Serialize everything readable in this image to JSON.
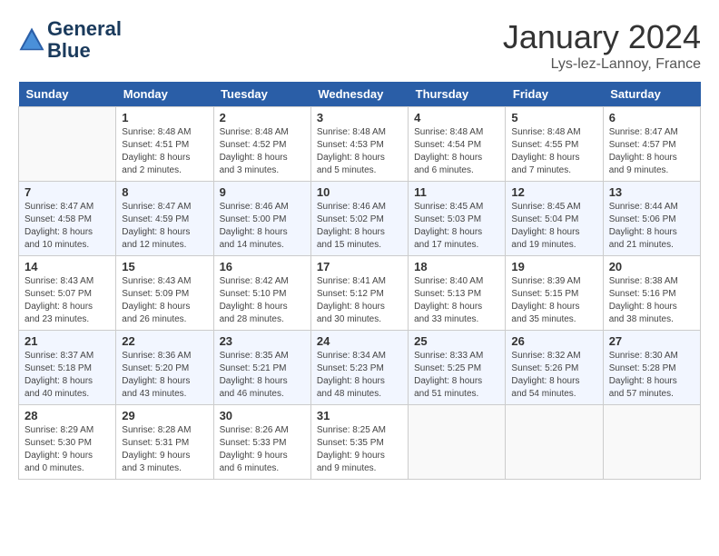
{
  "header": {
    "logo_line1": "General",
    "logo_line2": "Blue",
    "month_year": "January 2024",
    "location": "Lys-lez-Lannoy, France"
  },
  "days_of_week": [
    "Sunday",
    "Monday",
    "Tuesday",
    "Wednesday",
    "Thursday",
    "Friday",
    "Saturday"
  ],
  "weeks": [
    [
      {
        "day": "",
        "empty": true
      },
      {
        "day": "1",
        "sunrise": "Sunrise: 8:48 AM",
        "sunset": "Sunset: 4:51 PM",
        "daylight": "Daylight: 8 hours and 2 minutes."
      },
      {
        "day": "2",
        "sunrise": "Sunrise: 8:48 AM",
        "sunset": "Sunset: 4:52 PM",
        "daylight": "Daylight: 8 hours and 3 minutes."
      },
      {
        "day": "3",
        "sunrise": "Sunrise: 8:48 AM",
        "sunset": "Sunset: 4:53 PM",
        "daylight": "Daylight: 8 hours and 5 minutes."
      },
      {
        "day": "4",
        "sunrise": "Sunrise: 8:48 AM",
        "sunset": "Sunset: 4:54 PM",
        "daylight": "Daylight: 8 hours and 6 minutes."
      },
      {
        "day": "5",
        "sunrise": "Sunrise: 8:48 AM",
        "sunset": "Sunset: 4:55 PM",
        "daylight": "Daylight: 8 hours and 7 minutes."
      },
      {
        "day": "6",
        "sunrise": "Sunrise: 8:47 AM",
        "sunset": "Sunset: 4:57 PM",
        "daylight": "Daylight: 8 hours and 9 minutes."
      }
    ],
    [
      {
        "day": "7",
        "sunrise": "Sunrise: 8:47 AM",
        "sunset": "Sunset: 4:58 PM",
        "daylight": "Daylight: 8 hours and 10 minutes."
      },
      {
        "day": "8",
        "sunrise": "Sunrise: 8:47 AM",
        "sunset": "Sunset: 4:59 PM",
        "daylight": "Daylight: 8 hours and 12 minutes."
      },
      {
        "day": "9",
        "sunrise": "Sunrise: 8:46 AM",
        "sunset": "Sunset: 5:00 PM",
        "daylight": "Daylight: 8 hours and 14 minutes."
      },
      {
        "day": "10",
        "sunrise": "Sunrise: 8:46 AM",
        "sunset": "Sunset: 5:02 PM",
        "daylight": "Daylight: 8 hours and 15 minutes."
      },
      {
        "day": "11",
        "sunrise": "Sunrise: 8:45 AM",
        "sunset": "Sunset: 5:03 PM",
        "daylight": "Daylight: 8 hours and 17 minutes."
      },
      {
        "day": "12",
        "sunrise": "Sunrise: 8:45 AM",
        "sunset": "Sunset: 5:04 PM",
        "daylight": "Daylight: 8 hours and 19 minutes."
      },
      {
        "day": "13",
        "sunrise": "Sunrise: 8:44 AM",
        "sunset": "Sunset: 5:06 PM",
        "daylight": "Daylight: 8 hours and 21 minutes."
      }
    ],
    [
      {
        "day": "14",
        "sunrise": "Sunrise: 8:43 AM",
        "sunset": "Sunset: 5:07 PM",
        "daylight": "Daylight: 8 hours and 23 minutes."
      },
      {
        "day": "15",
        "sunrise": "Sunrise: 8:43 AM",
        "sunset": "Sunset: 5:09 PM",
        "daylight": "Daylight: 8 hours and 26 minutes."
      },
      {
        "day": "16",
        "sunrise": "Sunrise: 8:42 AM",
        "sunset": "Sunset: 5:10 PM",
        "daylight": "Daylight: 8 hours and 28 minutes."
      },
      {
        "day": "17",
        "sunrise": "Sunrise: 8:41 AM",
        "sunset": "Sunset: 5:12 PM",
        "daylight": "Daylight: 8 hours and 30 minutes."
      },
      {
        "day": "18",
        "sunrise": "Sunrise: 8:40 AM",
        "sunset": "Sunset: 5:13 PM",
        "daylight": "Daylight: 8 hours and 33 minutes."
      },
      {
        "day": "19",
        "sunrise": "Sunrise: 8:39 AM",
        "sunset": "Sunset: 5:15 PM",
        "daylight": "Daylight: 8 hours and 35 minutes."
      },
      {
        "day": "20",
        "sunrise": "Sunrise: 8:38 AM",
        "sunset": "Sunset: 5:16 PM",
        "daylight": "Daylight: 8 hours and 38 minutes."
      }
    ],
    [
      {
        "day": "21",
        "sunrise": "Sunrise: 8:37 AM",
        "sunset": "Sunset: 5:18 PM",
        "daylight": "Daylight: 8 hours and 40 minutes."
      },
      {
        "day": "22",
        "sunrise": "Sunrise: 8:36 AM",
        "sunset": "Sunset: 5:20 PM",
        "daylight": "Daylight: 8 hours and 43 minutes."
      },
      {
        "day": "23",
        "sunrise": "Sunrise: 8:35 AM",
        "sunset": "Sunset: 5:21 PM",
        "daylight": "Daylight: 8 hours and 46 minutes."
      },
      {
        "day": "24",
        "sunrise": "Sunrise: 8:34 AM",
        "sunset": "Sunset: 5:23 PM",
        "daylight": "Daylight: 8 hours and 48 minutes."
      },
      {
        "day": "25",
        "sunrise": "Sunrise: 8:33 AM",
        "sunset": "Sunset: 5:25 PM",
        "daylight": "Daylight: 8 hours and 51 minutes."
      },
      {
        "day": "26",
        "sunrise": "Sunrise: 8:32 AM",
        "sunset": "Sunset: 5:26 PM",
        "daylight": "Daylight: 8 hours and 54 minutes."
      },
      {
        "day": "27",
        "sunrise": "Sunrise: 8:30 AM",
        "sunset": "Sunset: 5:28 PM",
        "daylight": "Daylight: 8 hours and 57 minutes."
      }
    ],
    [
      {
        "day": "28",
        "sunrise": "Sunrise: 8:29 AM",
        "sunset": "Sunset: 5:30 PM",
        "daylight": "Daylight: 9 hours and 0 minutes."
      },
      {
        "day": "29",
        "sunrise": "Sunrise: 8:28 AM",
        "sunset": "Sunset: 5:31 PM",
        "daylight": "Daylight: 9 hours and 3 minutes."
      },
      {
        "day": "30",
        "sunrise": "Sunrise: 8:26 AM",
        "sunset": "Sunset: 5:33 PM",
        "daylight": "Daylight: 9 hours and 6 minutes."
      },
      {
        "day": "31",
        "sunrise": "Sunrise: 8:25 AM",
        "sunset": "Sunset: 5:35 PM",
        "daylight": "Daylight: 9 hours and 9 minutes."
      },
      {
        "day": "",
        "empty": true
      },
      {
        "day": "",
        "empty": true
      },
      {
        "day": "",
        "empty": true
      }
    ]
  ]
}
